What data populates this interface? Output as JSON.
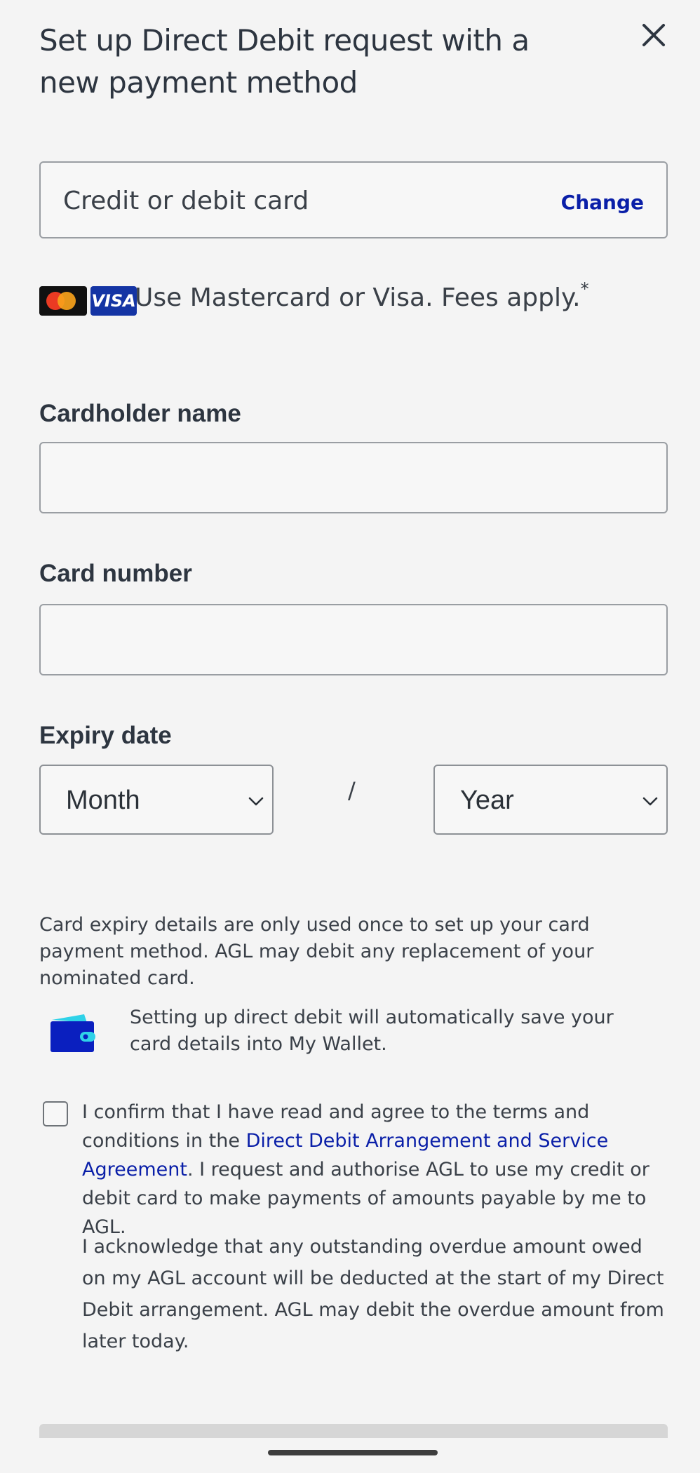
{
  "modal": {
    "title": "Set up Direct Debit request with a new payment method"
  },
  "payment_method": {
    "label": "Credit or debit card",
    "change_label": "Change"
  },
  "card_notice": {
    "logos": [
      "mastercard-logo",
      "visa-logo"
    ],
    "visa_text": "VISA",
    "text": "Use Mastercard or Visa. Fees apply.",
    "footnote_marker": "*"
  },
  "form": {
    "cardholder_label": "Cardholder name",
    "cardholder_value": "",
    "card_number_label": "Card number",
    "card_number_value": "",
    "expiry_label": "Expiry date",
    "month_selected": "Month",
    "year_selected": "Year",
    "separator": "/"
  },
  "info": {
    "expiry_note": "Card expiry details are only used once to set up your card payment method. AGL may debit any replacement of your nominated card.",
    "wallet_note": "Setting up direct debit will automatically save your card details into My Wallet."
  },
  "consent": {
    "checked": false,
    "text_before": "I confirm that I have read and agree to the terms and conditions in the ",
    "link_text": "Direct Debit Arrangement and Service Agreement",
    "text_after": ". I request and authorise AGL to use my credit or debit card to make payments of amounts payable by me to AGL.",
    "acknowledgement": "I acknowledge that any outstanding overdue amount owed on my AGL account will be deducted at the start of my Direct Debit arrangement. AGL may debit the overdue amount from later today."
  },
  "colors": {
    "background": "#f4f4f4",
    "link": "#0a1fa8",
    "wallet_blue": "#0a1fbf",
    "wallet_accent": "#2fd2e8",
    "visa_blue": "#1434a4"
  }
}
